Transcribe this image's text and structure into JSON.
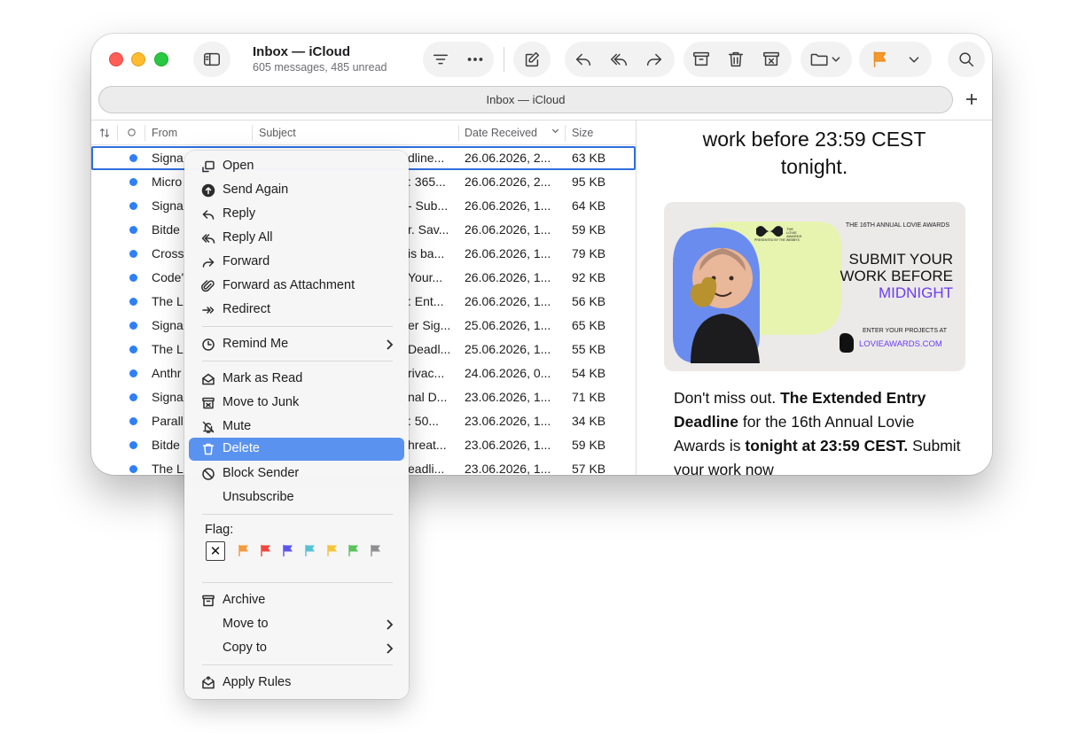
{
  "window": {
    "title": "Inbox — iCloud",
    "subtitle": "605 messages, 485 unread",
    "tab_title": "Inbox — iCloud"
  },
  "list": {
    "columns": {
      "from": "From",
      "subject": "Subject",
      "date": "Date Received",
      "size": "Size"
    },
    "rows": [
      {
        "from": "Signa",
        "subject": "dline...",
        "date": "26.06.2026, 2...",
        "size": "63 KB",
        "unread": true,
        "selected": true
      },
      {
        "from": "Micro",
        "subject": ": 365...",
        "date": "26.06.2026, 2...",
        "size": "95 KB",
        "unread": true
      },
      {
        "from": "Signa",
        "subject": "- Sub...",
        "date": "26.06.2026, 1...",
        "size": "64 KB",
        "unread": true
      },
      {
        "from": "Bitde",
        "subject": "r. Sav...",
        "date": "26.06.2026, 1...",
        "size": "59 KB",
        "unread": true
      },
      {
        "from": "Cross",
        "subject": "is ba...",
        "date": "26.06.2026, 1...",
        "size": "79 KB",
        "unread": true
      },
      {
        "from": "Code'",
        "subject": "Your...",
        "date": "26.06.2026, 1...",
        "size": "92 KB",
        "unread": true
      },
      {
        "from": "The L",
        "subject": ": Ent...",
        "date": "26.06.2026, 1...",
        "size": "56 KB",
        "unread": true
      },
      {
        "from": "Signa",
        "subject": "er Sig...",
        "date": "25.06.2026, 1...",
        "size": "65 KB",
        "unread": true
      },
      {
        "from": "The L",
        "subject": "Deadl...",
        "date": "25.06.2026, 1...",
        "size": "55 KB",
        "unread": true
      },
      {
        "from": "Anthr",
        "subject": "rivac...",
        "date": "24.06.2026, 0...",
        "size": "54 KB",
        "unread": true
      },
      {
        "from": "Signa",
        "subject": "nal D...",
        "date": "23.06.2026, 1...",
        "size": "71 KB",
        "unread": true
      },
      {
        "from": "Parall",
        "subject": ": 50...",
        "date": "23.06.2026, 1...",
        "size": "34 KB",
        "unread": true
      },
      {
        "from": "Bitde",
        "subject": "hreat...",
        "date": "23.06.2026, 1...",
        "size": "59 KB",
        "unread": true
      },
      {
        "from": "The L",
        "subject": "eadli...",
        "date": "23.06.2026, 1...",
        "size": "57 KB",
        "unread": true
      }
    ]
  },
  "preview": {
    "heading_line1": "work before 23:59 CEST",
    "heading_line2": "tonight.",
    "banner": {
      "award_caption": "THE 16TH ANNUAL LOVIE AWARDS",
      "logo_text_1": "THE",
      "logo_text_2": "LOVIE",
      "logo_text_3": "AWARDS",
      "logo_sub": "PRESENTED BY THE WEBBYS",
      "cta_line1": "SUBMIT YOUR",
      "cta_line2": "WORK BEFORE",
      "cta_line3": "MIDNIGHT",
      "enter_text": "ENTER YOUR PROJECTS AT",
      "url": "LOVIEAWARDS.COM",
      "accent_color": "#6a3df0",
      "lime_color": "#e7f4b0",
      "blue_color": "#6b8cef"
    },
    "body_p1": "Don't miss out.",
    "body_b1": "The Extended Entry Deadline",
    "body_p2": "for the 16th Annual Lovie Awards is",
    "body_b2": "tonight at 23:59 CEST.",
    "body_p3": "Submit your work now"
  },
  "menu": {
    "items": {
      "open": "Open",
      "send_again": "Send Again",
      "reply": "Reply",
      "reply_all": "Reply All",
      "forward": "Forward",
      "forward_attachment": "Forward as Attachment",
      "redirect": "Redirect",
      "remind_me": "Remind Me",
      "mark_read": "Mark as Read",
      "move_junk": "Move to Junk",
      "mute": "Mute",
      "delete": "Delete",
      "block_sender": "Block Sender",
      "unsubscribe": "Unsubscribe",
      "flag": "Flag:",
      "archive": "Archive",
      "move_to": "Move to",
      "copy_to": "Copy to",
      "apply_rules": "Apply Rules"
    },
    "highlighted": "Delete",
    "flag_colors": [
      "#f49a3b",
      "#f0463c",
      "#5b55e8",
      "#56c2d6",
      "#f4c63b",
      "#5ac25a",
      "#8e8e93"
    ]
  }
}
